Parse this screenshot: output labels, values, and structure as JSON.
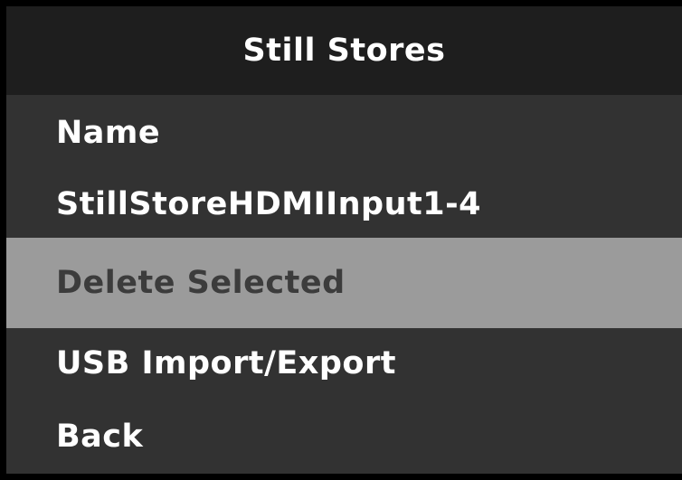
{
  "title": "Still Stores",
  "menu": {
    "items": [
      {
        "label": "Name"
      },
      {
        "label": "StillStoreHDMIInput1-4"
      },
      {
        "label": "Delete Selected",
        "selected": true
      },
      {
        "label": "USB Import/Export"
      },
      {
        "label": "Back"
      }
    ]
  },
  "colors": {
    "title_bar": "#1e1e1e",
    "menu_background": "#323232",
    "selected_background": "#9b9b9b",
    "text": "#ffffff",
    "selected_text": "#3c3c3c"
  }
}
